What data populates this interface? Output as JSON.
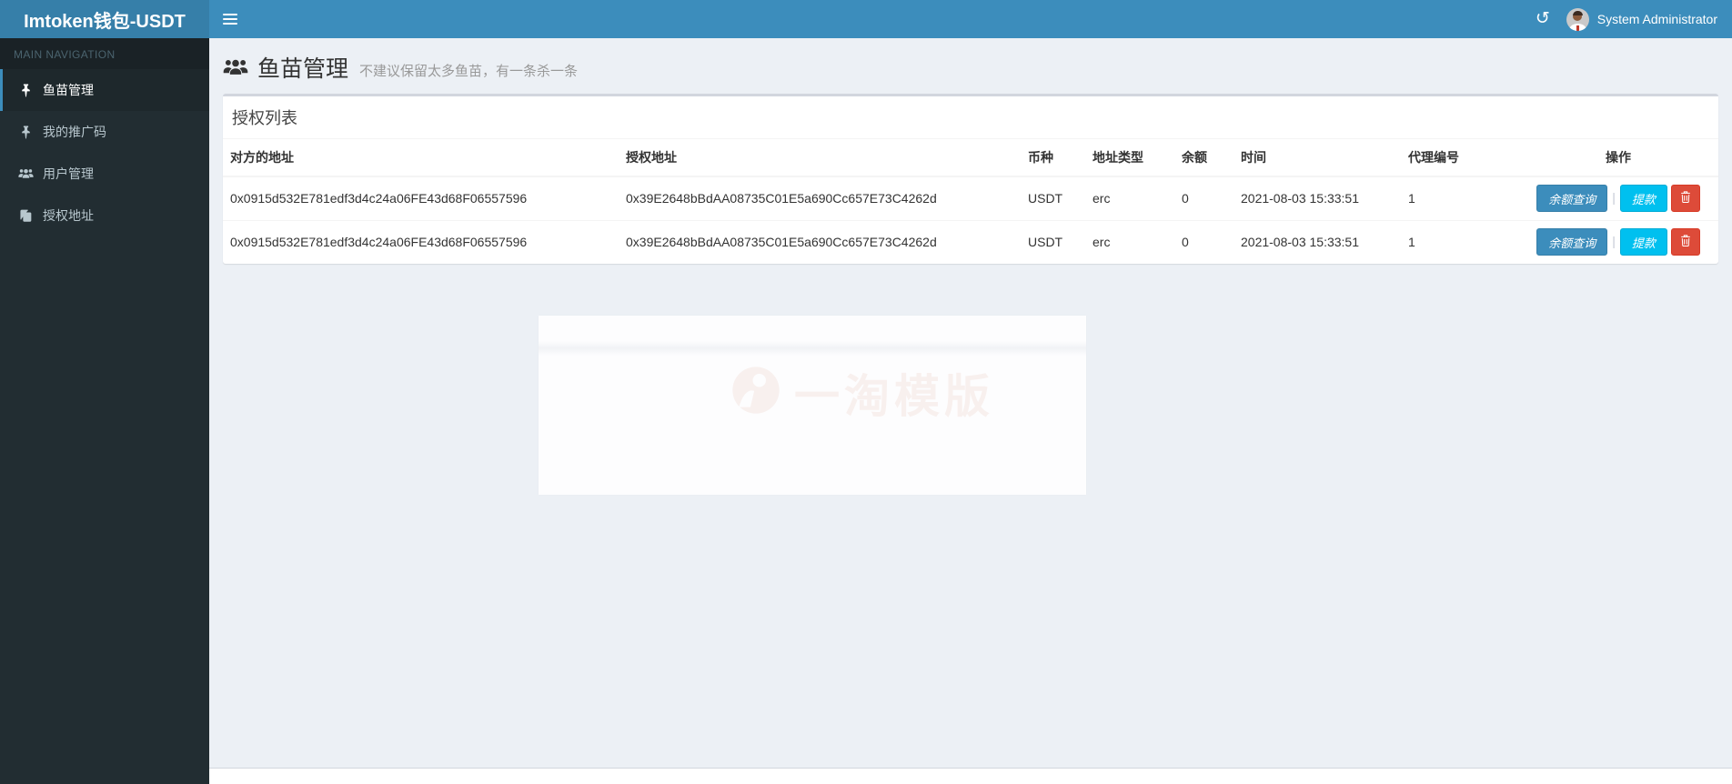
{
  "header": {
    "brand": "Imtoken钱包-USDT",
    "user_name": "System Administrator"
  },
  "sidebar": {
    "section_label": "MAIN NAVIGATION",
    "items": [
      {
        "label": "鱼苗管理",
        "icon": "thumbtack-icon",
        "active": true
      },
      {
        "label": "我的推广码",
        "icon": "thumbtack-icon",
        "active": false
      },
      {
        "label": "用户管理",
        "icon": "users-icon",
        "active": false
      },
      {
        "label": "授权地址",
        "icon": "copy-icon",
        "active": false
      }
    ]
  },
  "page": {
    "title": "鱼苗管理",
    "subtitle": "不建议保留太多鱼苗，有一条杀一条"
  },
  "panel": {
    "title": "授权列表"
  },
  "table": {
    "headers": [
      "对方的地址",
      "授权地址",
      "币种",
      "地址类型",
      "余额",
      "时间",
      "代理编号",
      "操作"
    ],
    "rows": [
      {
        "peer_address": "0x0915d532E781edf3d4c24a06FE43d68F06557596",
        "auth_address": "0x39E2648bBdAA08735C01E5a690Cc657E73C4262d",
        "coin": "USDT",
        "address_type": "erc",
        "balance": "0",
        "time": "2021-08-03 15:33:51",
        "agent_no": "1"
      },
      {
        "peer_address": "0x0915d532E781edf3d4c24a06FE43d68F06557596",
        "auth_address": "0x39E2648bBdAA08735C01E5a690Cc657E73C4262d",
        "coin": "USDT",
        "address_type": "erc",
        "balance": "0",
        "time": "2021-08-03 15:33:51",
        "agent_no": "1"
      }
    ]
  },
  "actions": {
    "balance_query": "余额查询",
    "withdraw": "提款",
    "separator": "|",
    "delete_icon": "trash-icon"
  },
  "navbar_icons": {
    "history": "history-icon"
  },
  "watermark": {
    "text": "一淘模版"
  },
  "colors": {
    "navbar": "#3c8dbc",
    "logo_bg": "#367fa9",
    "sidebar_bg": "#222d32",
    "sidebar_active_bg": "#1e282c",
    "accent": "#3c8dbc",
    "info": "#00c0ef",
    "danger": "#dd4b39",
    "content_bg": "#ecf0f5"
  }
}
